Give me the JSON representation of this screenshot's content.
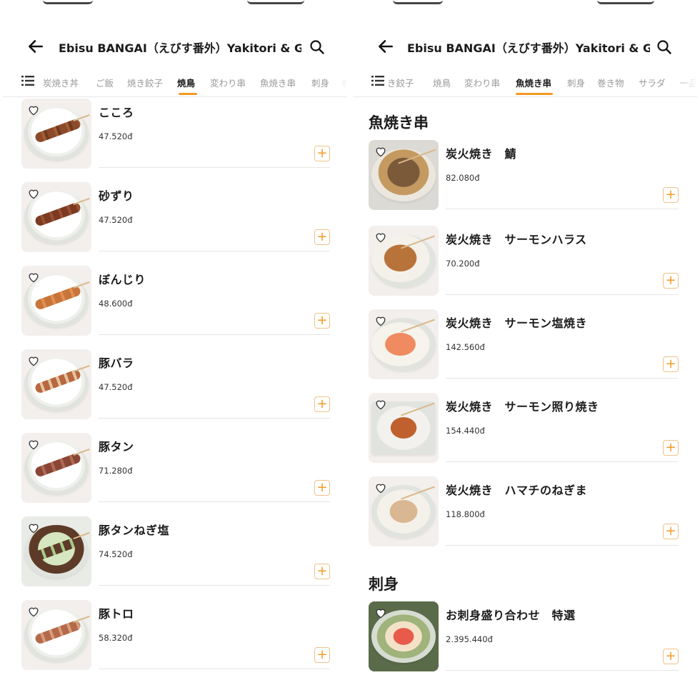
{
  "colors": {
    "accent": "#f59a23",
    "text": "#1b1b1b",
    "muted": "#9a9a9a"
  },
  "left": {
    "title": "Ebisu BANGAI（えびす番外）Yakitori & Gy...",
    "tabs": [
      "炭焼き丼",
      "ご飯",
      "焼き餃子",
      "焼鳥",
      "変わり串",
      "魚焼き串",
      "刺身",
      "巻"
    ],
    "active_tab": "焼鳥",
    "items": [
      {
        "name": "こころ",
        "price": "47.520đ"
      },
      {
        "name": "砂ずり",
        "price": "47.520đ"
      },
      {
        "name": "ぼんじり",
        "price": "48.600đ"
      },
      {
        "name": "豚バラ",
        "price": "47.520đ"
      },
      {
        "name": "豚タン",
        "price": "71.280đ"
      },
      {
        "name": "豚タンねぎ塩",
        "price": "74.520đ"
      },
      {
        "name": "豚トロ",
        "price": "58.320đ"
      }
    ],
    "add_label": "+"
  },
  "right": {
    "title": "Ebisu BANGAI（えびす番外）Yakitori & Gy...",
    "tabs": [
      "き餃子",
      "焼鳥",
      "変わり串",
      "魚焼き串",
      "刺身",
      "巻き物",
      "サラダ",
      "一品"
    ],
    "active_tab": "魚焼き串",
    "section1": "魚焼き串",
    "section2": "刺身",
    "items": [
      {
        "name": "炭火焼き　鯖",
        "price": "82.080đ"
      },
      {
        "name": "炭火焼き　サーモンハラス",
        "price": "70.200đ"
      },
      {
        "name": "炭火焼き　サーモン塩焼き",
        "price": "142.560đ"
      },
      {
        "name": "炭火焼き　サーモン照り焼き",
        "price": "154.440đ"
      },
      {
        "name": "炭火焼き　ハマチのねぎま",
        "price": "118.800đ"
      },
      {
        "name": "お刺身盛り合わせ　特選",
        "price": "2.395.440đ"
      }
    ],
    "add_label": "+"
  },
  "icons": {
    "back": "arrow-left-icon",
    "search": "search-icon",
    "menu": "menu-list-icon",
    "heart": "heart-outline-icon"
  }
}
